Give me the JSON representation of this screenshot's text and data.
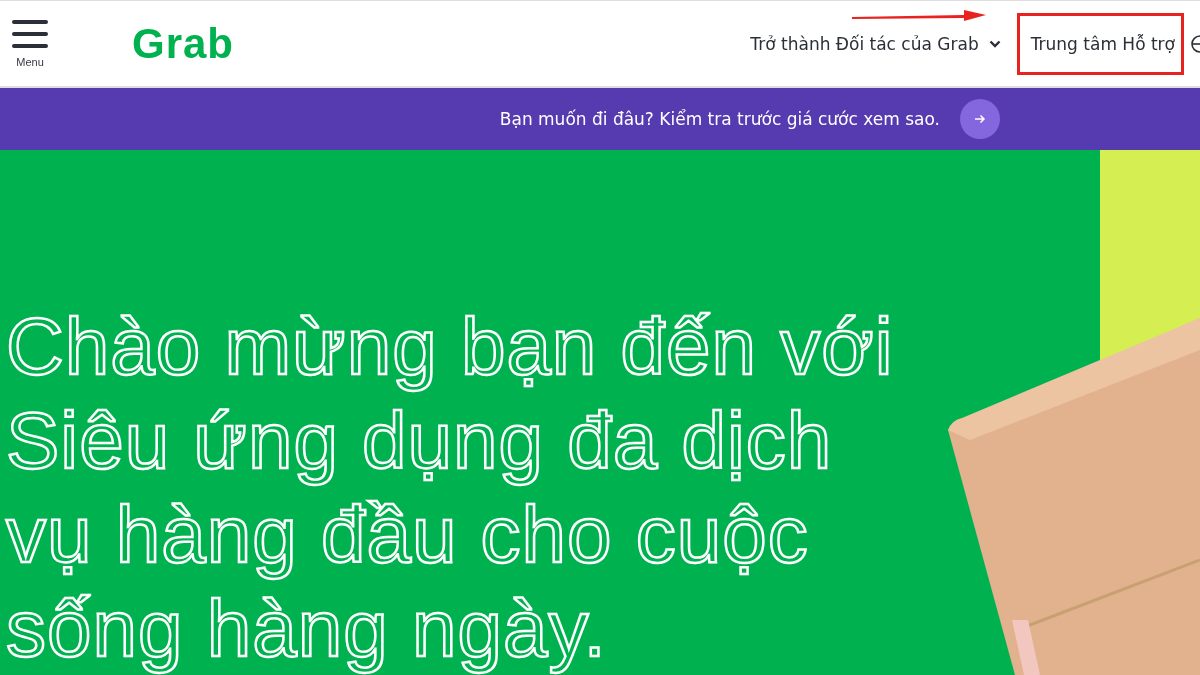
{
  "header": {
    "menu_label": "Menu",
    "logo": "Grab",
    "nav": [
      {
        "label": "Trở thành Đối tác của Grab",
        "kind": "dropdown",
        "highlighted": false
      },
      {
        "label": "Trung tâm Hỗ trợ",
        "kind": "link",
        "highlighted": true
      }
    ]
  },
  "banner": {
    "text": "Bạn muốn đi đâu? Kiểm tra trước giá cước xem sao."
  },
  "hero": {
    "heading": "Chào mừng bạn đến với Siêu ứng dụng đa dịch vụ hàng đầu cho cuộc sống hàng ngày."
  }
}
